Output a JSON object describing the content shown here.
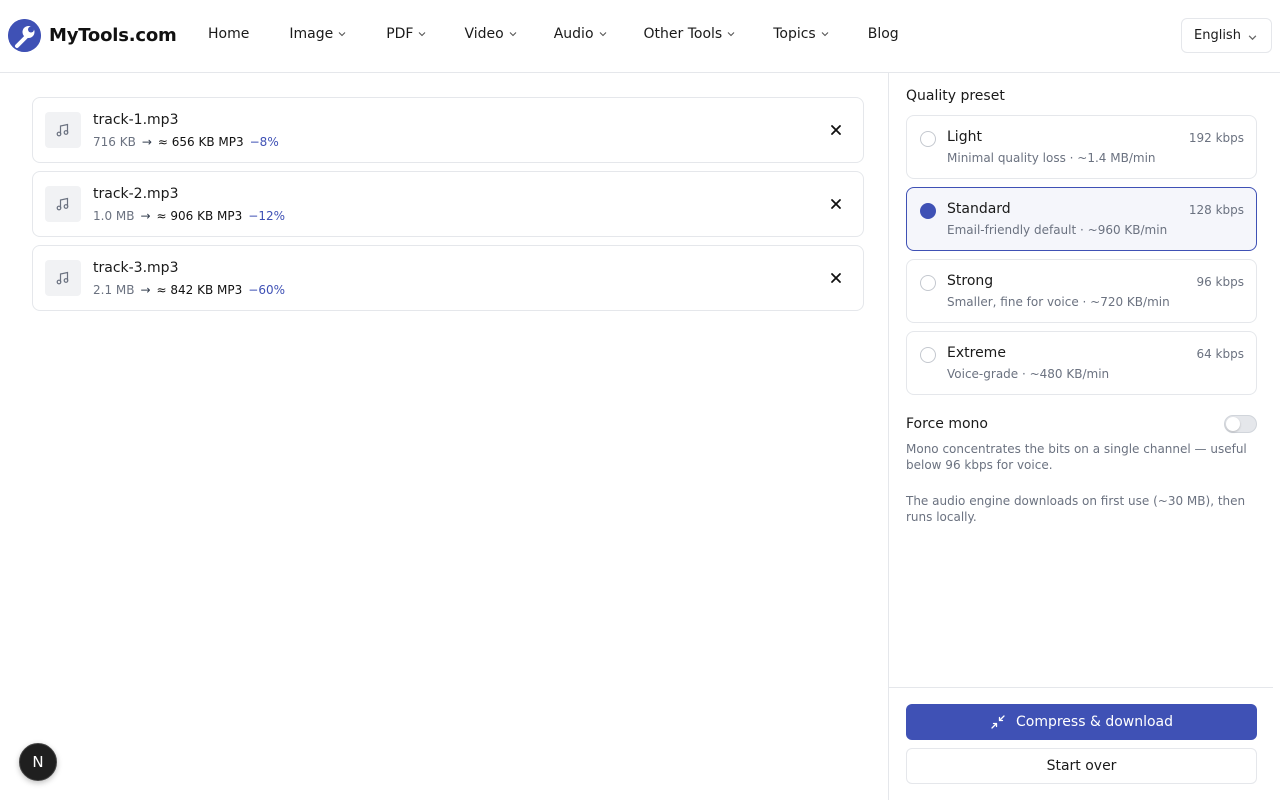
{
  "brand": {
    "name": "MyTools.com",
    "accent": "#3f51b5"
  },
  "nav": [
    {
      "label": "Home",
      "dropdown": false
    },
    {
      "label": "Image",
      "dropdown": true
    },
    {
      "label": "PDF",
      "dropdown": true
    },
    {
      "label": "Video",
      "dropdown": true
    },
    {
      "label": "Audio",
      "dropdown": true
    },
    {
      "label": "Other Tools",
      "dropdown": true
    },
    {
      "label": "Topics",
      "dropdown": true
    },
    {
      "label": "Blog",
      "dropdown": false
    }
  ],
  "language": {
    "selected": "English"
  },
  "files": [
    {
      "name": "track-1.mp3",
      "original": "716 KB",
      "arrow": "→",
      "estimate": "≈ 656 KB MP3",
      "change": "−8%",
      "icon": "music-note-icon"
    },
    {
      "name": "track-2.mp3",
      "original": "1.0 MB",
      "arrow": "→",
      "estimate": "≈ 906 KB MP3",
      "change": "−12%",
      "icon": "music-note-icon"
    },
    {
      "name": "track-3.mp3",
      "original": "2.1 MB",
      "arrow": "→",
      "estimate": "≈ 842 KB MP3",
      "change": "−60%",
      "icon": "music-note-icon"
    }
  ],
  "settings": {
    "quality_title": "Quality preset",
    "presets": [
      {
        "name": "Light",
        "bitrate": "192 kbps",
        "description": "Minimal quality loss · ~1.4 MB/min",
        "selected": false
      },
      {
        "name": "Standard",
        "bitrate": "128 kbps",
        "description": "Email-friendly default · ~960 KB/min",
        "selected": true
      },
      {
        "name": "Strong",
        "bitrate": "96 kbps",
        "description": "Smaller, fine for voice · ~720 KB/min",
        "selected": false
      },
      {
        "name": "Extreme",
        "bitrate": "64 kbps",
        "description": "Voice-grade · ~480 KB/min",
        "selected": false
      }
    ],
    "mono_label": "Force mono",
    "mono_enabled": false,
    "mono_help": "Mono concentrates the bits on a single channel — useful below 96 kbps for voice.",
    "engine_note": "The audio engine downloads on first use (~30 MB), then runs locally."
  },
  "actions": {
    "primary_label": "Compress & download",
    "primary_icon": "compress-arrows-icon",
    "secondary_label": "Start over"
  },
  "fab": {
    "label": "N"
  }
}
